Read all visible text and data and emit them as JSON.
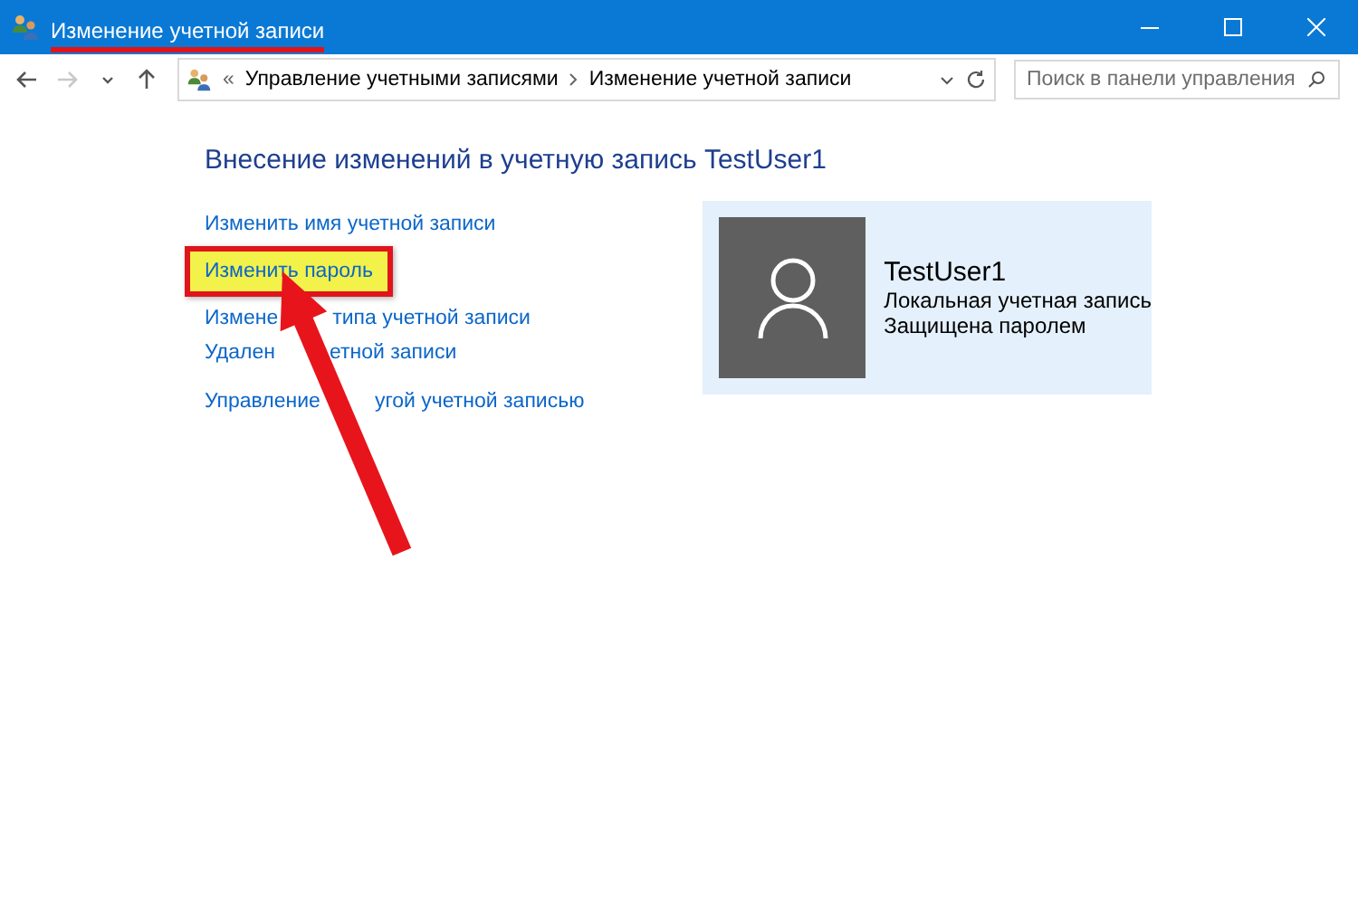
{
  "window": {
    "title": "Изменение учетной записи",
    "title_underlined": true
  },
  "nav": [
    {
      "kind": "back",
      "disabled": false
    },
    {
      "kind": "forward",
      "disabled": true
    },
    {
      "kind": "recent",
      "disabled": false
    },
    {
      "kind": "up",
      "disabled": false
    }
  ],
  "address": {
    "overflow": "«",
    "crumbs": [
      "Управление учетными записями",
      "Изменение учетной записи"
    ]
  },
  "search": {
    "placeholder": "Поиск в панели управления"
  },
  "heading": "Внесение изменений в учетную запись TestUser1",
  "task_groups": [
    [
      {
        "parts": [
          "Изменить имя учетной записи"
        ],
        "highlighted": false
      },
      {
        "parts": [
          "Изменить пароль"
        ],
        "highlighted": true
      },
      {
        "parts": [
          "Измене",
          "типа учетной записи"
        ],
        "highlighted": false
      },
      {
        "parts": [
          "Удален",
          "етной записи"
        ],
        "highlighted": false
      }
    ],
    [
      {
        "parts": [
          "Управление",
          "угой учетной записью"
        ],
        "highlighted": false
      }
    ]
  ],
  "account": {
    "name": "TestUser1",
    "lines": [
      "Локальная учетная запись",
      "Защищена паролем"
    ]
  },
  "annotation_arrow": true
}
